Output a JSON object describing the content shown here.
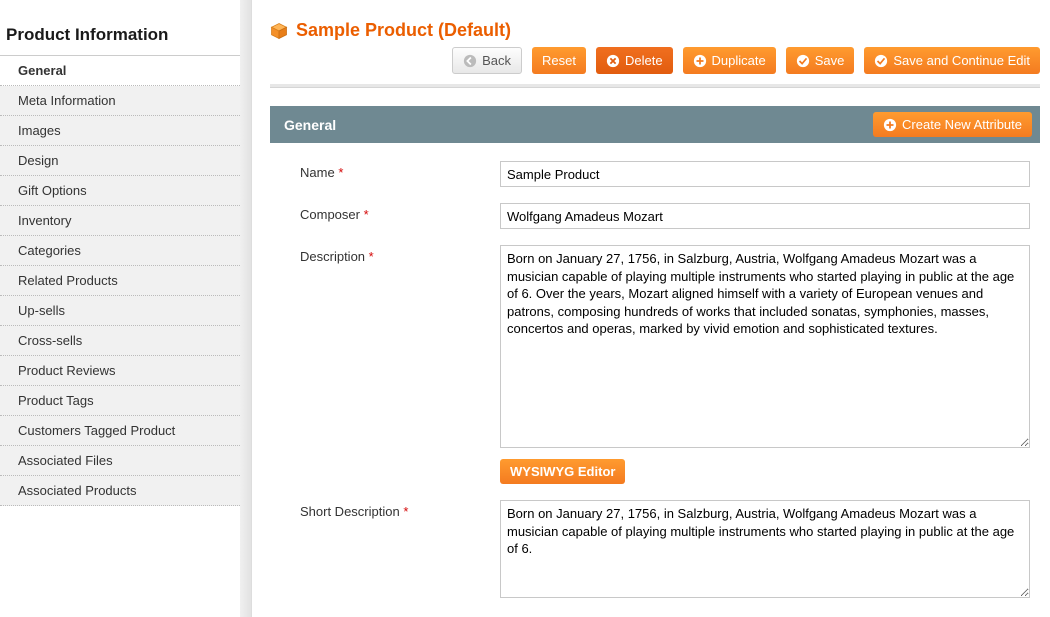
{
  "sidebar": {
    "title": "Product Information",
    "items": [
      {
        "label": "General",
        "active": true
      },
      {
        "label": "Meta Information"
      },
      {
        "label": "Images"
      },
      {
        "label": "Design"
      },
      {
        "label": "Gift Options"
      },
      {
        "label": "Inventory"
      },
      {
        "label": "Categories"
      },
      {
        "label": "Related Products"
      },
      {
        "label": "Up-sells"
      },
      {
        "label": "Cross-sells"
      },
      {
        "label": "Product Reviews"
      },
      {
        "label": "Product Tags"
      },
      {
        "label": "Customers Tagged Product"
      },
      {
        "label": "Associated Files"
      },
      {
        "label": "Associated Products"
      }
    ]
  },
  "header": {
    "title": "Sample Product (Default)"
  },
  "toolbar": {
    "back": "Back",
    "reset": "Reset",
    "delete": "Delete",
    "duplicate": "Duplicate",
    "save": "Save",
    "save_continue": "Save and Continue Edit"
  },
  "section": {
    "title": "General",
    "create_attr": "Create New Attribute"
  },
  "form": {
    "name_label": "Name",
    "name_value": "Sample Product",
    "composer_label": "Composer",
    "composer_value": "Wolfgang Amadeus Mozart",
    "description_label": "Description",
    "description_value": "Born on January 27, 1756, in Salzburg, Austria, Wolfgang Amadeus Mozart was a musician capable of playing multiple instruments who started playing in public at the age of 6. Over the years, Mozart aligned himself with a variety of European venues and patrons, composing hundreds of works that included sonatas, symphonies, masses, concertos and operas, marked by vivid emotion and sophisticated textures.",
    "wysiwyg": "WYSIWYG Editor",
    "short_desc_label": "Short Description",
    "short_desc_value": "Born on January 27, 1756, in Salzburg, Austria, Wolfgang Amadeus Mozart was a musician capable of playing multiple instruments who started playing in public at the age of 6."
  }
}
